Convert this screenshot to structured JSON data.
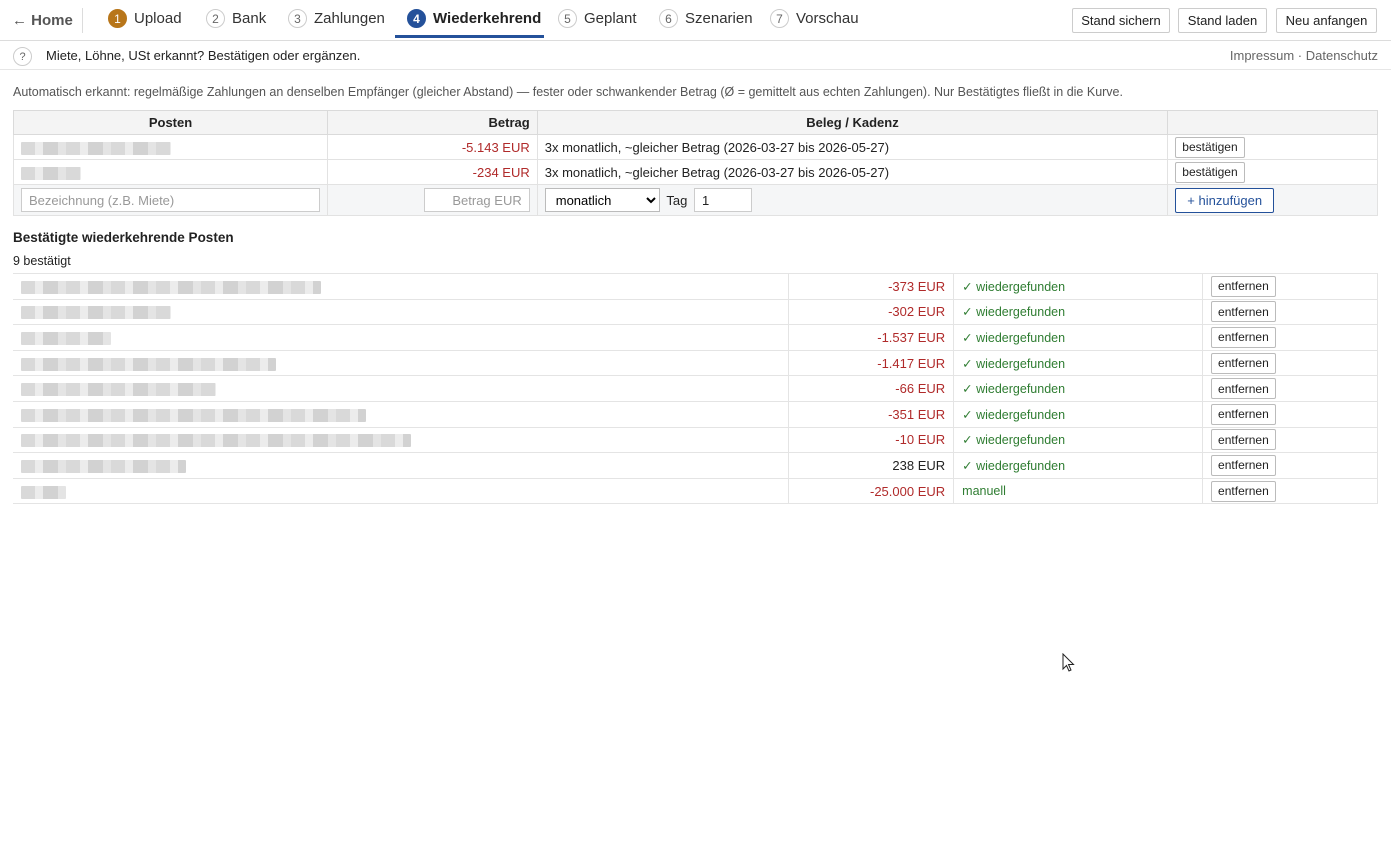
{
  "nav": {
    "home": "← Home",
    "steps": [
      {
        "num": "1",
        "label": "Upload"
      },
      {
        "num": "2",
        "label": "Bank"
      },
      {
        "num": "3",
        "label": "Zahlungen"
      },
      {
        "num": "4",
        "label": "Wiederkehrend"
      },
      {
        "num": "5",
        "label": "Geplant"
      },
      {
        "num": "6",
        "label": "Szenarien"
      },
      {
        "num": "7",
        "label": "Vorschau"
      }
    ],
    "active_step": "Wiederkehrend",
    "buttons": {
      "save": "Stand sichern",
      "load": "Stand laden",
      "reset": "Neu anfangen"
    }
  },
  "hint": {
    "icon": "?",
    "text": "Miete, Löhne, USt erkannt? Bestätigen oder ergänzen.",
    "links": "Impressum · Datenschutz"
  },
  "intro": "Automatisch erkannt: regelmäßige Zahlungen an denselben Empfänger (gleicher Abstand) — fester oder schwankender Betrag (Ø = gemittelt aus echten Zahlungen). Nur Bestätigtes fließt in die Kurve.",
  "detected": {
    "headers": {
      "posten": "Posten",
      "betrag": "Betrag",
      "beleg": "Beleg / Kadenz"
    },
    "rows": [
      {
        "amount": "-5.143 EUR",
        "cadence": "3x monatlich, ~gleicher Betrag (2026-03-27 bis 2026-05-27)",
        "action": "bestätigen"
      },
      {
        "amount": "-234 EUR",
        "cadence": "3x monatlich, ~gleicher Betrag (2026-03-27 bis 2026-05-27)",
        "action": "bestätigen"
      }
    ],
    "add": {
      "name_placeholder": "Bezeichnung (z.B. Miete)",
      "amount_placeholder": "Betrag EUR",
      "interval": "monatlich",
      "day_label": "Tag",
      "day_value": "1",
      "button": "+ hinzufügen"
    }
  },
  "confirmed": {
    "title": "Bestätigte wiederkehrende Posten",
    "count": "9 bestätigt",
    "rows": [
      {
        "amount": "-373 EUR",
        "status": "✓ wiedergefunden",
        "action": "entfernen"
      },
      {
        "amount": "-302 EUR",
        "status": "✓ wiedergefunden",
        "action": "entfernen"
      },
      {
        "amount": "-1.537 EUR",
        "status": "✓ wiedergefunden",
        "action": "entfernen"
      },
      {
        "amount": "-1.417 EUR",
        "status": "✓ wiedergefunden",
        "action": "entfernen"
      },
      {
        "amount": "-66 EUR",
        "status": "✓ wiedergefunden",
        "action": "entfernen"
      },
      {
        "amount": "-351 EUR",
        "status": "✓ wiedergefunden",
        "action": "entfernen"
      },
      {
        "amount": "-10 EUR",
        "status": "✓ wiedergefunden",
        "action": "entfernen"
      },
      {
        "amount": "238 EUR",
        "status": "✓ wiedergefunden",
        "action": "entfernen"
      },
      {
        "amount": "-25.000 EUR",
        "status": "manuell",
        "action": "entfernen"
      }
    ]
  },
  "colors": {
    "accent": "#24519a",
    "done_step": "#b8761a",
    "negative": "#b02a2a",
    "success": "#2f7d32"
  }
}
